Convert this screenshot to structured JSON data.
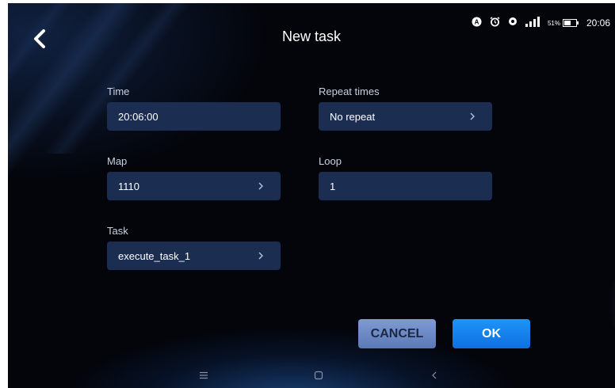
{
  "header": {
    "title": "New task",
    "back_icon": "chevron-left-icon"
  },
  "status_bar": {
    "icons": [
      "a-circle-icon",
      "alarm-icon",
      "location-icon",
      "signal-icon"
    ],
    "battery_percent": "51%",
    "time": "20:06"
  },
  "form": {
    "time": {
      "label": "Time",
      "value": "20:06:00"
    },
    "repeat_times": {
      "label": "Repeat times",
      "value": "No repeat"
    },
    "map": {
      "label": "Map",
      "value": "1110"
    },
    "loop": {
      "label": "Loop",
      "value": "1"
    },
    "task": {
      "label": "Task",
      "value": "execute_task_1"
    }
  },
  "actions": {
    "cancel_label": "CANCEL",
    "ok_label": "OK"
  },
  "nav_bar": {
    "icons": [
      "menu-icon",
      "home-icon",
      "back-icon"
    ]
  },
  "colors": {
    "background": "#03050b",
    "field": "#1c2d52",
    "cancel": "#6f8bc8",
    "ok": "#1683ee"
  }
}
